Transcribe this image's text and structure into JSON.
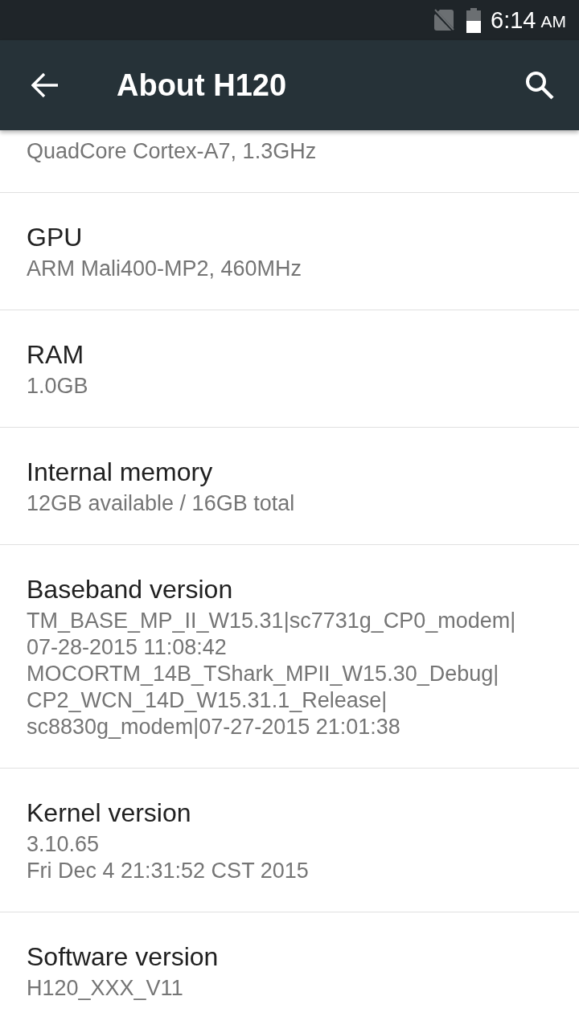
{
  "status_bar": {
    "time": "6:14",
    "meridiem": "AM"
  },
  "toolbar": {
    "title": "About H120"
  },
  "items": [
    {
      "summary": "QuadCore Cortex-A7, 1.3GHz"
    },
    {
      "title": "GPU",
      "summary": "ARM Mali400-MP2, 460MHz"
    },
    {
      "title": "RAM",
      "summary": "1.0GB"
    },
    {
      "title": "Internal memory",
      "summary": "12GB available / 16GB total"
    },
    {
      "title": "Baseband version",
      "summary": "TM_BASE_MP_II_W15.31|sc7731g_CP0_modem|\n07-28-2015 11:08:42\nMOCORTM_14B_TShark_MPII_W15.30_Debug|\nCP2_WCN_14D_W15.31.1_Release|\nsc8830g_modem|07-27-2015 21:01:38"
    },
    {
      "title": "Kernel version",
      "summary": "3.10.65\nFri Dec 4 21:31:52 CST 2015"
    },
    {
      "title": "Software version",
      "summary": "H120_XXX_V11"
    }
  ]
}
